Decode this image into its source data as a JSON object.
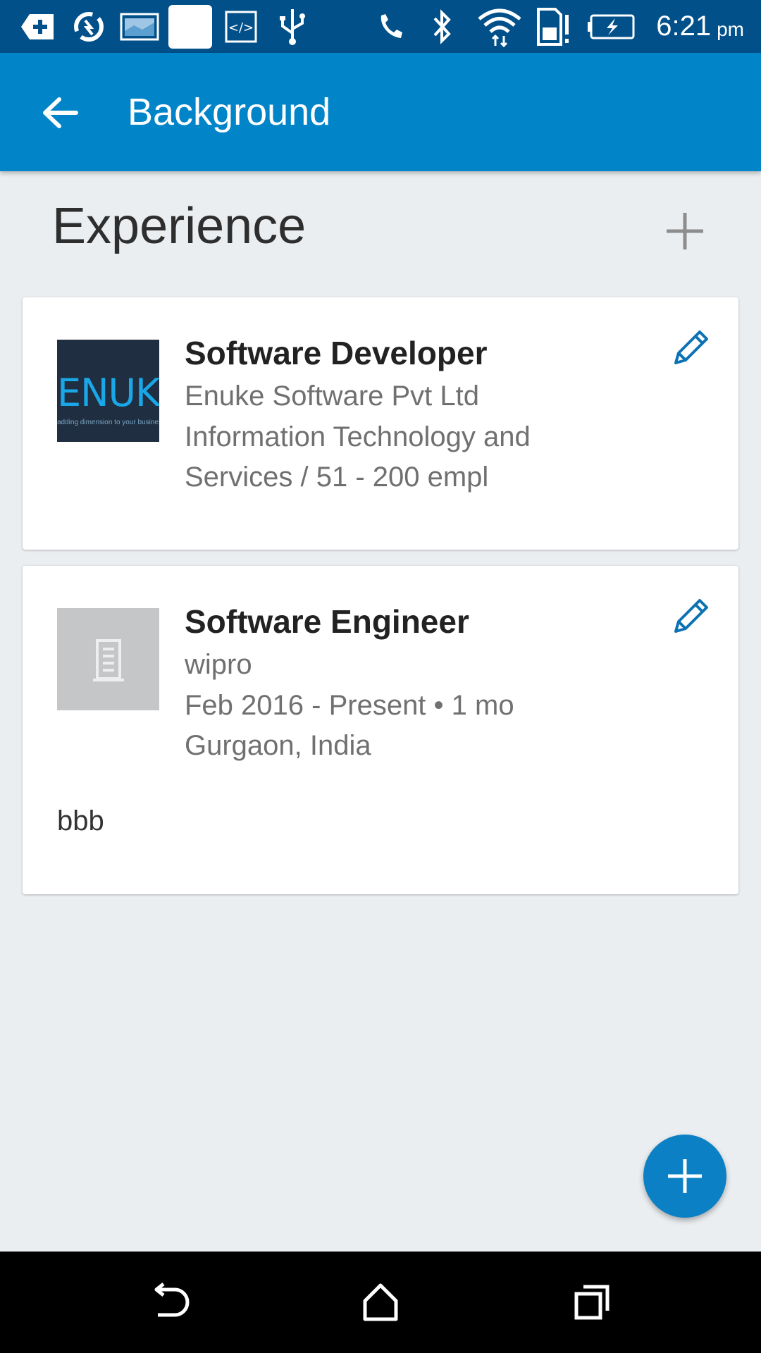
{
  "status_bar": {
    "time": "6:21",
    "ampm": "pm",
    "icons": [
      "add-box-icon",
      "sync-icon",
      "photo-icon",
      "blank-icon",
      "code-icon",
      "usb-icon",
      "phone-icon",
      "bluetooth-icon",
      "wifi-icon",
      "sim-card-icon",
      "battery-charging-icon"
    ]
  },
  "app_bar": {
    "title": "Background",
    "back_icon": "arrow-back-icon",
    "color": "#0285c8"
  },
  "section": {
    "title": "Experience",
    "add_icon": "plus-icon"
  },
  "experience": [
    {
      "title": "Software Developer",
      "company": "Enuke Software Pvt Ltd",
      "line2": "Information Technology and",
      "line3": "Services / 51 - 200 empl",
      "logo": {
        "brand": "ENUKE",
        "tagline": "adding dimension to your business"
      },
      "edit_icon": "pencil-icon"
    },
    {
      "title": "Software Engineer",
      "company": "wipro",
      "line2": "Feb 2016 - Present • 1 mo",
      "line3": "Gurgaon, India",
      "description": "bbb",
      "logo_icon": "building-icon",
      "edit_icon": "pencil-icon"
    }
  ],
  "fab": {
    "icon": "plus-icon",
    "color": "#0b80c4"
  },
  "nav_bar": {
    "icons": [
      "back-icon",
      "home-icon",
      "recents-icon"
    ]
  }
}
